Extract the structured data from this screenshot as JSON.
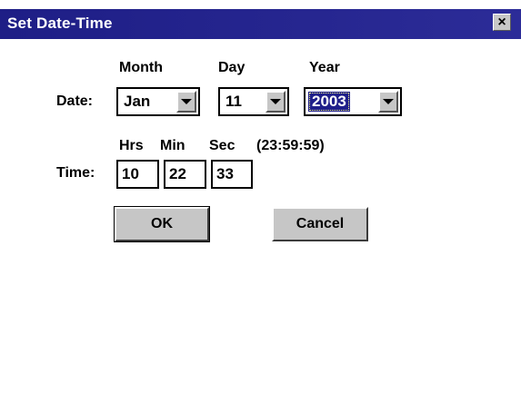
{
  "window": {
    "title": "Set Date-Time",
    "close_label": "×"
  },
  "date": {
    "label": "Date:",
    "month": {
      "header": "Month",
      "value": "Jan"
    },
    "day": {
      "header": "Day",
      "value": "11"
    },
    "year": {
      "header": "Year",
      "value": "2003"
    }
  },
  "time": {
    "label": "Time:",
    "hrs_header": "Hrs",
    "min_header": "Min",
    "sec_header": "Sec",
    "format_hint": "(23:59:59)",
    "hrs": "10",
    "min": "22",
    "sec": "33"
  },
  "buttons": {
    "ok": "OK",
    "cancel": "Cancel"
  }
}
